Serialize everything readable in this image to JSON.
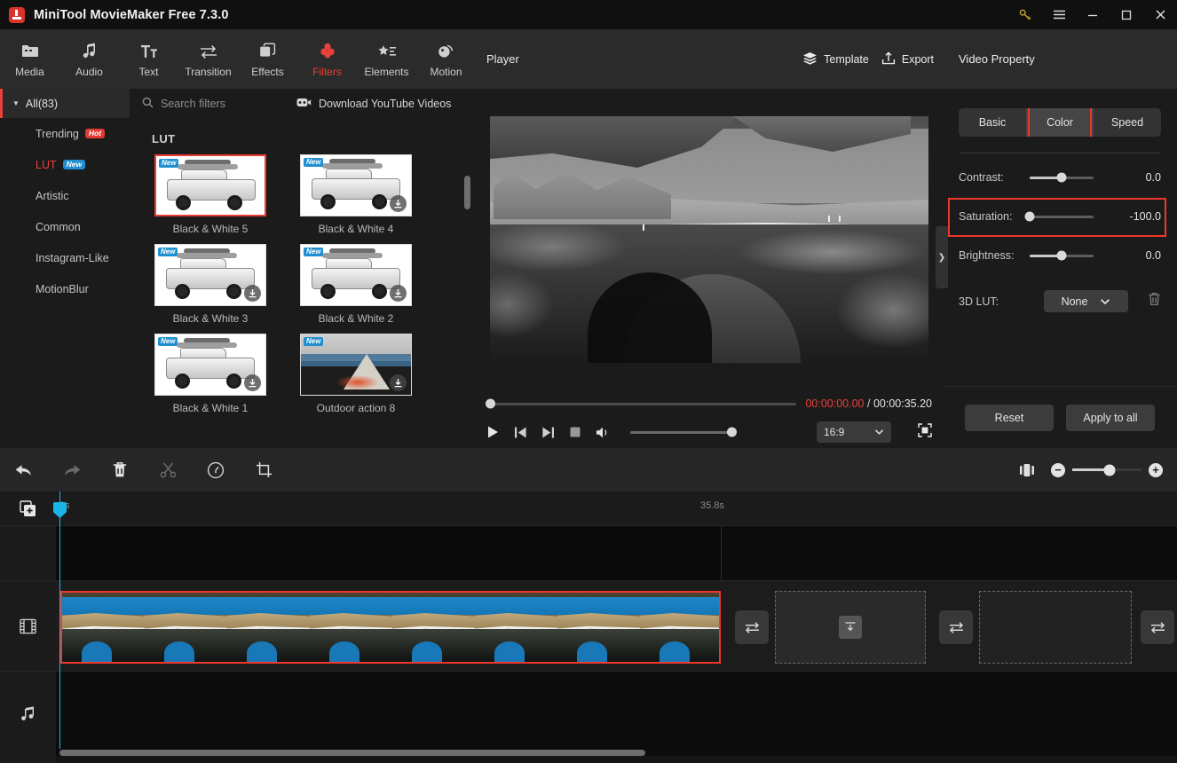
{
  "window": {
    "title": "MiniTool MovieMaker Free 7.3.0",
    "controls": {
      "key": "key-icon",
      "menu": "menu-icon",
      "minimize": "—",
      "maximize": "□",
      "close": "✕"
    }
  },
  "navbar": {
    "items": [
      {
        "label": "Media",
        "icon": "media-folder-icon",
        "active": false
      },
      {
        "label": "Audio",
        "icon": "music-note-icon",
        "active": false
      },
      {
        "label": "Text",
        "icon": "text-icon",
        "active": false
      },
      {
        "label": "Transition",
        "icon": "transition-arrows-icon",
        "active": false
      },
      {
        "label": "Effects",
        "icon": "effects-layers-icon",
        "active": false
      },
      {
        "label": "Filters",
        "icon": "filters-icon",
        "active": true
      },
      {
        "label": "Elements",
        "icon": "elements-star-icon",
        "active": false
      },
      {
        "label": "Motion",
        "icon": "motion-icon",
        "active": false
      }
    ],
    "accent": "#e8413a"
  },
  "categories": {
    "all": {
      "label": "All(83)"
    },
    "items": [
      {
        "label": "Trending",
        "badge": "Hot",
        "badge_type": "hot",
        "selected": false
      },
      {
        "label": "LUT",
        "badge": "New",
        "badge_type": "new",
        "selected": true
      },
      {
        "label": "Artistic",
        "badge": "",
        "badge_type": "",
        "selected": false
      },
      {
        "label": "Common",
        "badge": "",
        "badge_type": "",
        "selected": false
      },
      {
        "label": "Instagram-Like",
        "badge": "",
        "badge_type": "",
        "selected": false
      },
      {
        "label": "MotionBlur",
        "badge": "",
        "badge_type": "",
        "selected": false
      }
    ]
  },
  "browser": {
    "search_placeholder": "Search filters",
    "download_label": "Download YouTube Videos",
    "group_title": "LUT",
    "filters": [
      {
        "name": "Black & White 5",
        "tag": "New",
        "selected": true,
        "downloadable": false,
        "art": "car"
      },
      {
        "name": "Black & White 4",
        "tag": "New",
        "selected": false,
        "downloadable": true,
        "art": "car"
      },
      {
        "name": "Black & White 3",
        "tag": "New",
        "selected": false,
        "downloadable": true,
        "art": "car"
      },
      {
        "name": "Black & White 2",
        "tag": "New",
        "selected": false,
        "downloadable": true,
        "art": "car"
      },
      {
        "name": "Black & White 1",
        "tag": "New",
        "selected": false,
        "downloadable": true,
        "art": "car"
      },
      {
        "name": "Outdoor action 8",
        "tag": "New",
        "selected": false,
        "downloadable": true,
        "art": "tent"
      }
    ]
  },
  "player": {
    "title": "Player",
    "template_label": "Template",
    "export_label": "Export",
    "current_time": "00:00:00.00",
    "separator": "/",
    "total_time": "00:00:35.20",
    "aspect_ratio": "16:9",
    "controls": {
      "play": "play-icon",
      "prev_frame": "previous-frame-icon",
      "next_frame": "next-frame-icon",
      "stop": "stop-icon",
      "volume": "volume-icon",
      "fullscreen": "fullscreen-icon"
    }
  },
  "property": {
    "title": "Video Property",
    "tabs": [
      {
        "label": "Basic",
        "active": false
      },
      {
        "label": "Color",
        "active": true,
        "highlighted": true
      },
      {
        "label": "Speed",
        "active": false
      }
    ],
    "rows": [
      {
        "label": "Contrast:",
        "value": "0.0",
        "pos": 50,
        "highlighted": false
      },
      {
        "label": "Saturation:",
        "value": "-100.0",
        "pos": 0,
        "highlighted": true
      },
      {
        "label": "Brightness:",
        "value": "0.0",
        "pos": 50,
        "highlighted": false
      }
    ],
    "lut": {
      "label": "3D LUT:",
      "value": "None",
      "delete_icon": "trash-icon"
    },
    "footer": {
      "reset": "Reset",
      "apply_all": "Apply to all"
    },
    "highlight_color": "#f0372c"
  },
  "timeline": {
    "toolbar": [
      {
        "icon": "undo-icon",
        "dim": false
      },
      {
        "icon": "redo-icon",
        "dim": true
      },
      {
        "icon": "delete-icon",
        "dim": false
      },
      {
        "icon": "split-icon",
        "dim": true
      },
      {
        "icon": "speed-icon",
        "dim": false
      },
      {
        "icon": "crop-icon",
        "dim": false
      }
    ],
    "right_tools": {
      "fit_icon": "fit-to-window-icon",
      "zoom_out": "−",
      "zoom_in": "+"
    },
    "add_track_icon": "add-media-icon",
    "ruler": {
      "start": "0s",
      "end": "35.8s"
    },
    "tracks": [
      {
        "icon": "",
        "type": "text"
      },
      {
        "icon": "film-icon",
        "type": "video"
      },
      {
        "icon": "music-icon",
        "type": "audio"
      }
    ],
    "clip": {
      "selected": true,
      "frames": 8
    },
    "slots": [
      {
        "type": "download",
        "icon": "download-icon"
      },
      {
        "type": "empty",
        "icon": ""
      }
    ],
    "gap_icon": "transition-gap-icon"
  }
}
